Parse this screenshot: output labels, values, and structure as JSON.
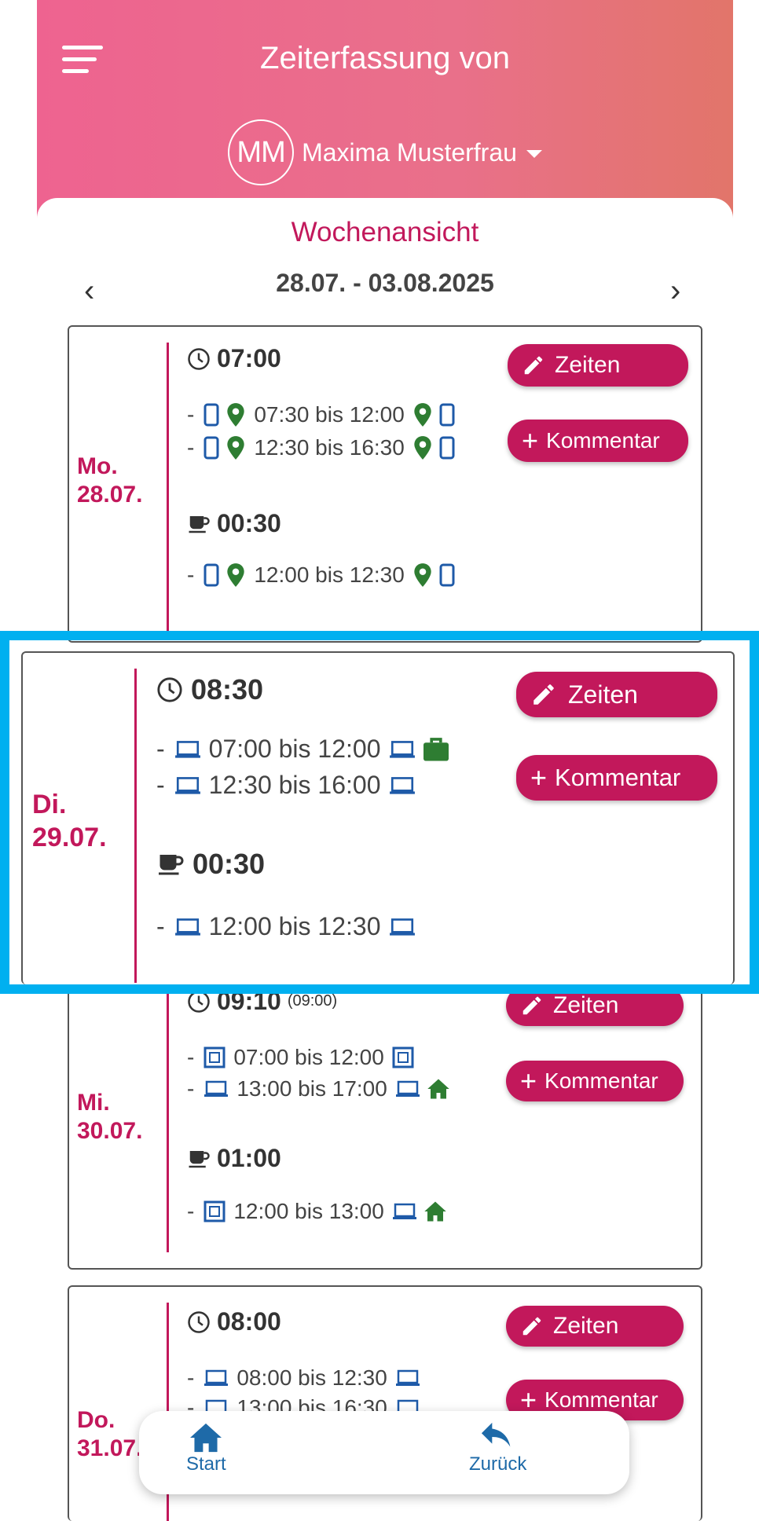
{
  "header": {
    "title": "Zeiterfassung von",
    "avatar_initials": "MM",
    "user_name": "Maxima Musterfrau"
  },
  "view": {
    "title": "Wochenansicht",
    "week_range": "28.07. - 03.08.2025",
    "prev": "‹",
    "next": "›"
  },
  "buttons": {
    "edit_label": "Zeiten",
    "comment_label": "Kommentar"
  },
  "days": [
    {
      "weekday": "Mo.",
      "date": "28.07.",
      "work_total": "07:00",
      "break_total": "00:30",
      "work_entries": [
        "07:30 bis 12:00",
        "12:30 bis 16:30"
      ],
      "break_entries": [
        "12:00 bis 12:30"
      ]
    },
    {
      "weekday": "Di.",
      "date": "29.07.",
      "work_total": "08:30",
      "break_total": "00:30",
      "work_entries": [
        "07:00 bis 12:00",
        "12:30 bis 16:00"
      ],
      "break_entries": [
        "12:00 bis 12:30"
      ]
    },
    {
      "weekday": "Mi.",
      "date": "30.07.",
      "work_total": "09:10",
      "work_target": "(09:00)",
      "break_total": "01:00",
      "work_entries": [
        "07:00 bis 12:00",
        "13:00 bis 17:00"
      ],
      "break_entries": [
        "12:00 bis 13:00"
      ]
    },
    {
      "weekday": "Do.",
      "date": "31.07.",
      "work_total": "08:00",
      "work_entries": [
        "08:00 bis 12:30",
        "13:00 bis 16:30"
      ]
    }
  ],
  "bottom_nav": {
    "home": "Start",
    "back": "Zurück"
  },
  "colors": {
    "accent": "#c2185b",
    "header_start": "#ee6390",
    "header_end": "#e2756a",
    "highlight": "#00b0f0",
    "icon_blue": "#1e5aa8",
    "icon_green": "#2e7d32"
  }
}
